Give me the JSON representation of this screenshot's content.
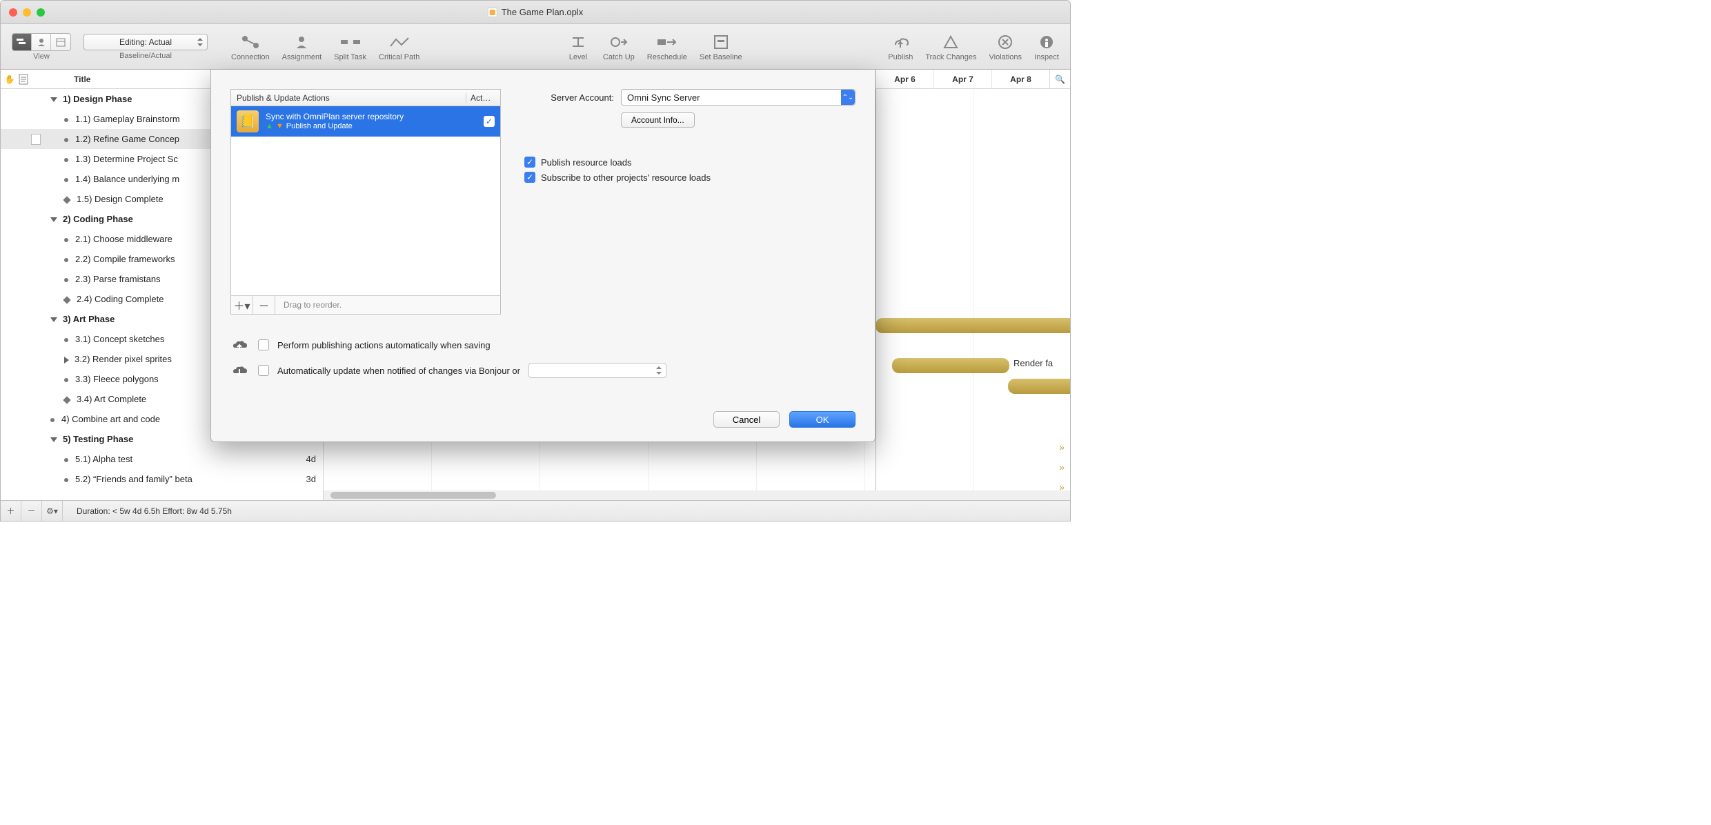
{
  "window": {
    "title": "The Game Plan.oplx"
  },
  "toolbar": {
    "view_label": "View",
    "baseline_label": "Baseline/Actual",
    "editing_pill": "Editing: Actual",
    "items": {
      "connection": "Connection",
      "assignment": "Assignment",
      "split_task": "Split Task",
      "critical_path": "Critical Path",
      "level": "Level",
      "catch_up": "Catch Up",
      "reschedule": "Reschedule",
      "set_baseline": "Set Baseline",
      "publish": "Publish",
      "track_changes": "Track Changes",
      "violations": "Violations",
      "inspect": "Inspect"
    }
  },
  "sidebar": {
    "header_title": "Title",
    "tasks": [
      {
        "k": "g",
        "n": "1)",
        "t": "Design Phase"
      },
      {
        "k": "i",
        "n": "1.1)",
        "t": "Gameplay Brainstorm"
      },
      {
        "k": "i",
        "n": "1.2)",
        "t": "Refine Game Concep",
        "sel": true,
        "page": true
      },
      {
        "k": "i",
        "n": "1.3)",
        "t": "Determine Project Sc"
      },
      {
        "k": "i",
        "n": "1.4)",
        "t": "Balance underlying m"
      },
      {
        "k": "m",
        "n": "1.5)",
        "t": "Design Complete"
      },
      {
        "k": "g",
        "n": "2)",
        "t": "Coding Phase"
      },
      {
        "k": "i",
        "n": "2.1)",
        "t": "Choose middleware"
      },
      {
        "k": "i",
        "n": "2.2)",
        "t": "Compile frameworks"
      },
      {
        "k": "i",
        "n": "2.3)",
        "t": "Parse framistans"
      },
      {
        "k": "m",
        "n": "2.4)",
        "t": "Coding Complete"
      },
      {
        "k": "g",
        "n": "3)",
        "t": "Art Phase"
      },
      {
        "k": "i",
        "n": "3.1)",
        "t": "Concept sketches"
      },
      {
        "k": "r",
        "n": "3.2)",
        "t": "Render pixel sprites"
      },
      {
        "k": "i",
        "n": "3.3)",
        "t": "Fleece polygons"
      },
      {
        "k": "m",
        "n": "3.4)",
        "t": "Art Complete"
      },
      {
        "k": "i0",
        "n": "4)",
        "t": "Combine art and code"
      },
      {
        "k": "g",
        "n": "5)",
        "t": "Testing Phase",
        "dur": "..."
      },
      {
        "k": "i",
        "n": "5.1)",
        "t": "Alpha test",
        "dur": "4d"
      },
      {
        "k": "i",
        "n": "5.2)",
        "t": "“Friends and family” beta",
        "dur": "3d"
      }
    ]
  },
  "gantt": {
    "dates": [
      "Apr 6",
      "Apr 7",
      "Apr 8"
    ],
    "render_label": "Render fa"
  },
  "footer": {
    "status": "Duration: < 5w 4d 6.5h Effort: 8w 4d 5.75h"
  },
  "dialog": {
    "list_header_actions": "Publish & Update Actions",
    "list_header_act": "Act…",
    "action_title": "Sync with OmniPlan server repository",
    "action_sub": "Publish and Update",
    "reorder_hint": "Drag to reorder.",
    "server_account_label": "Server Account:",
    "server_account_value": "Omni Sync Server",
    "account_info": "Account Info...",
    "publish_loads": "Publish resource loads",
    "subscribe_loads": "Subscribe to other projects' resource loads",
    "auto_publish": "Perform publishing actions automatically when saving",
    "auto_update": "Automatically update when notified of changes via Bonjour or",
    "cancel": "Cancel",
    "ok": "OK"
  }
}
